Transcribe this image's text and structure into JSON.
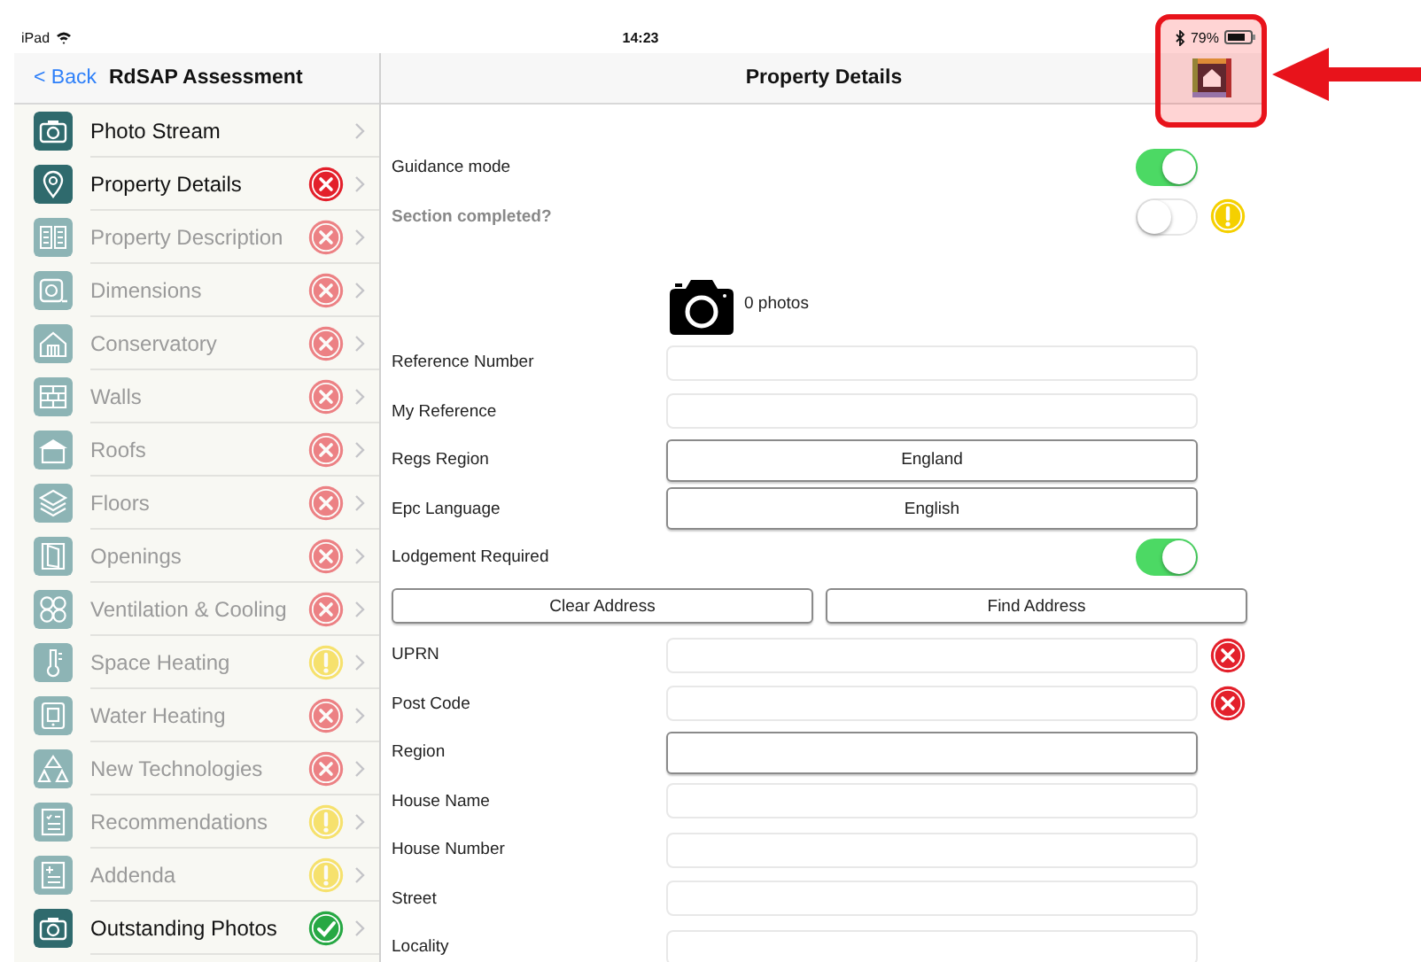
{
  "status_bar": {
    "device": "iPad",
    "time": "14:23",
    "battery": "79%"
  },
  "sidebar": {
    "back": "< Back",
    "title": "RdSAP Assessment",
    "items": [
      {
        "label": "Photo Stream",
        "disabled": false
      },
      {
        "label": "Property Details",
        "disabled": false,
        "badge": {
          "kind": "error"
        }
      },
      {
        "label": "Property Description",
        "disabled": true,
        "badge": {
          "kind": "error"
        }
      },
      {
        "label": "Dimensions",
        "disabled": true,
        "badge": {
          "kind": "error"
        }
      },
      {
        "label": "Conservatory",
        "disabled": true,
        "badge": {
          "kind": "error"
        }
      },
      {
        "label": "Walls",
        "disabled": true,
        "badge": {
          "kind": "error"
        }
      },
      {
        "label": "Roofs",
        "disabled": true,
        "badge": {
          "kind": "error"
        }
      },
      {
        "label": "Floors",
        "disabled": true,
        "badge": {
          "kind": "error"
        }
      },
      {
        "label": "Openings",
        "disabled": true,
        "badge": {
          "kind": "error"
        }
      },
      {
        "label": "Ventilation & Cooling",
        "disabled": true,
        "badge": {
          "kind": "error"
        }
      },
      {
        "label": "Space Heating",
        "disabled": true,
        "badge": {
          "kind": "warning"
        }
      },
      {
        "label": "Water Heating",
        "disabled": true,
        "badge": {
          "kind": "error"
        }
      },
      {
        "label": "New Technologies",
        "disabled": true,
        "badge": {
          "kind": "error"
        }
      },
      {
        "label": "Recommendations",
        "disabled": true,
        "badge": {
          "kind": "warning"
        }
      },
      {
        "label": "Addenda",
        "disabled": true,
        "badge": {
          "kind": "warning"
        }
      },
      {
        "label": "Outstanding Photos",
        "disabled": false,
        "badge": {
          "kind": "ok"
        }
      }
    ]
  },
  "detail": {
    "title": "Property Details",
    "rows": [
      {
        "kind": "toggle",
        "label": "Guidance mode",
        "on": true
      },
      {
        "kind": "completion",
        "label": "Section completed?",
        "on": false,
        "badge": {
          "kind": "warning"
        }
      },
      {
        "kind": "photos",
        "count": "0 photos"
      },
      {
        "kind": "text",
        "label": "Reference Number"
      },
      {
        "kind": "text",
        "label": "My Reference"
      },
      {
        "kind": "picker",
        "label": "Regs Region",
        "value": "England"
      },
      {
        "kind": "picker",
        "label": "Epc Language",
        "value": "English"
      },
      {
        "kind": "toggle",
        "label": "Lodgement Required",
        "on": true
      },
      {
        "kind": "buttons",
        "buttons": [
          "Clear Address",
          "Find Address"
        ]
      },
      {
        "kind": "text",
        "label": "UPRN",
        "badge": {
          "kind": "error"
        }
      },
      {
        "kind": "text",
        "label": "Post Code",
        "badge": {
          "kind": "error"
        }
      },
      {
        "kind": "picker",
        "label": "Region"
      },
      {
        "kind": "text",
        "label": "House Name"
      },
      {
        "kind": "text",
        "label": "House Number"
      },
      {
        "kind": "text",
        "label": "Street"
      },
      {
        "kind": "text",
        "label": "Locality"
      }
    ]
  }
}
